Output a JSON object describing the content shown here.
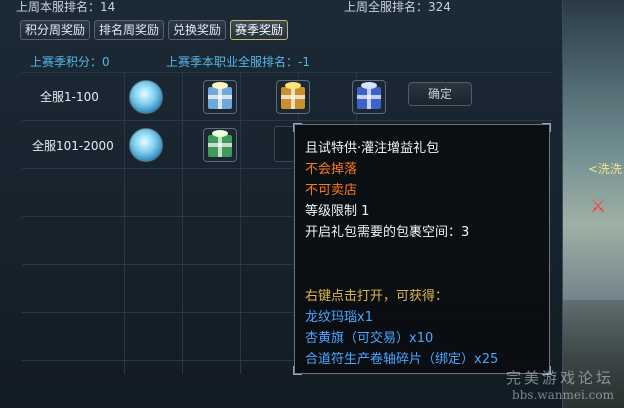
{
  "header": {
    "last_week_server_rank": "上周本服排名：14",
    "last_week_all_rank": "上周全服排名：324"
  },
  "tabs": [
    {
      "label": "积分周奖励"
    },
    {
      "label": "排名周奖励"
    },
    {
      "label": "兑换奖励"
    },
    {
      "label": "赛季奖励",
      "active": true
    }
  ],
  "stats": {
    "last_season_points": "上赛季积分：0",
    "last_season_class_rank": "上赛季本职业全服排名：-1"
  },
  "rows": [
    {
      "label": "全服1-100"
    },
    {
      "label": "全服101-2000"
    }
  ],
  "confirm_label": "确定",
  "tooltip": {
    "title": "且试特供·灌注增益礼包",
    "no_drop": "不会掉落",
    "no_sell": "不可卖店",
    "level_limit": "等级限制 1",
    "bag_space": "开启礼包需要的包裹空间：3",
    "open_hint": "右键点击打开，可获得：",
    "rewards": [
      "龙纹玛瑙x1",
      "杏黄旗（可交易）x10",
      "合道符生产卷轴碎片（绑定）x25"
    ]
  },
  "side": {
    "wash_text": "<洗洗",
    "sword_text": "!"
  },
  "watermark": {
    "line1": "完美游戏论坛",
    "line2": "bbs.wanmei.com"
  },
  "colors": {
    "orange": "#ff7a1a",
    "gold": "#e0b54d",
    "blue": "#4aa6ff",
    "label_blue": "#59b5e8"
  }
}
